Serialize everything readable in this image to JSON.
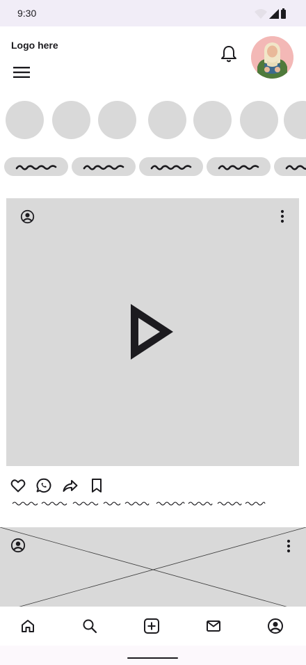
{
  "status_bar": {
    "time": "9:30",
    "icons": [
      "wifi-icon",
      "cellular-signal-icon",
      "battery-icon"
    ]
  },
  "header": {
    "logo_text": "Logo here",
    "menu_icon": "hamburger-menu-icon",
    "notification_icon": "bell-icon",
    "avatar": "user-avatar-illustration"
  },
  "stories": {
    "count_visible": 7
  },
  "chips": {
    "count_visible": 5,
    "label_style": "scribble-placeholder"
  },
  "feed": {
    "post_1": {
      "user_icon": "account-circle-icon",
      "more_icon": "more-vertical-icon",
      "media_icon": "play-icon",
      "actions": [
        "heart-icon",
        "comment-icon",
        "share-icon",
        "bookmark-icon"
      ],
      "caption_style": "scribble-placeholder"
    },
    "post_2": {
      "user_icon": "account-circle-icon",
      "more_icon": "more-vertical-icon",
      "media": "image-placeholder"
    }
  },
  "bottom_nav": {
    "items": [
      "home-icon",
      "search-icon",
      "add-box-icon",
      "mail-icon",
      "account-circle-icon"
    ]
  },
  "colors": {
    "status_bar_bg": "#f1edf7",
    "placeholder_gray": "#d9d9d9",
    "icon_dark": "#1c1b1f",
    "avatar_bg": "#f3b8b6"
  }
}
